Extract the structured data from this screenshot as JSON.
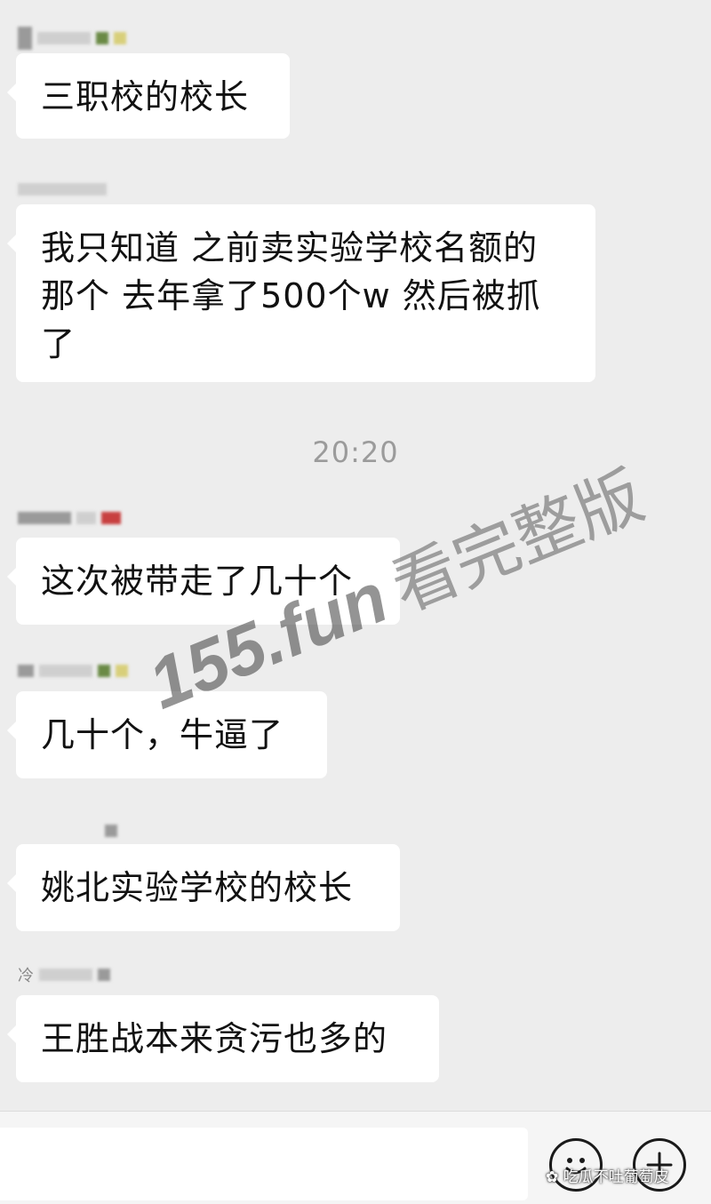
{
  "messages": [
    {
      "text": "三职校的校长"
    },
    {
      "text": "我只知道 之前卖实验学校名额的那个 去年拿了500个w 然后被抓了"
    },
    {
      "text": "这次被带走了几十个"
    },
    {
      "text": "几十个，牛逼了"
    },
    {
      "text": "姚北实验学校的校长"
    },
    {
      "text": "王胜战本来贪污也多的"
    }
  ],
  "timestamp": "20:20",
  "sender_partial": "冷",
  "watermark": {
    "domain": "155.fun",
    "label": "看完整版"
  },
  "input_bar": {
    "input_value": "",
    "emoji_icon": "smiley-face-icon",
    "plus_icon": "plus-circle-icon"
  },
  "credit": "吃瓜不吐葡萄皮"
}
